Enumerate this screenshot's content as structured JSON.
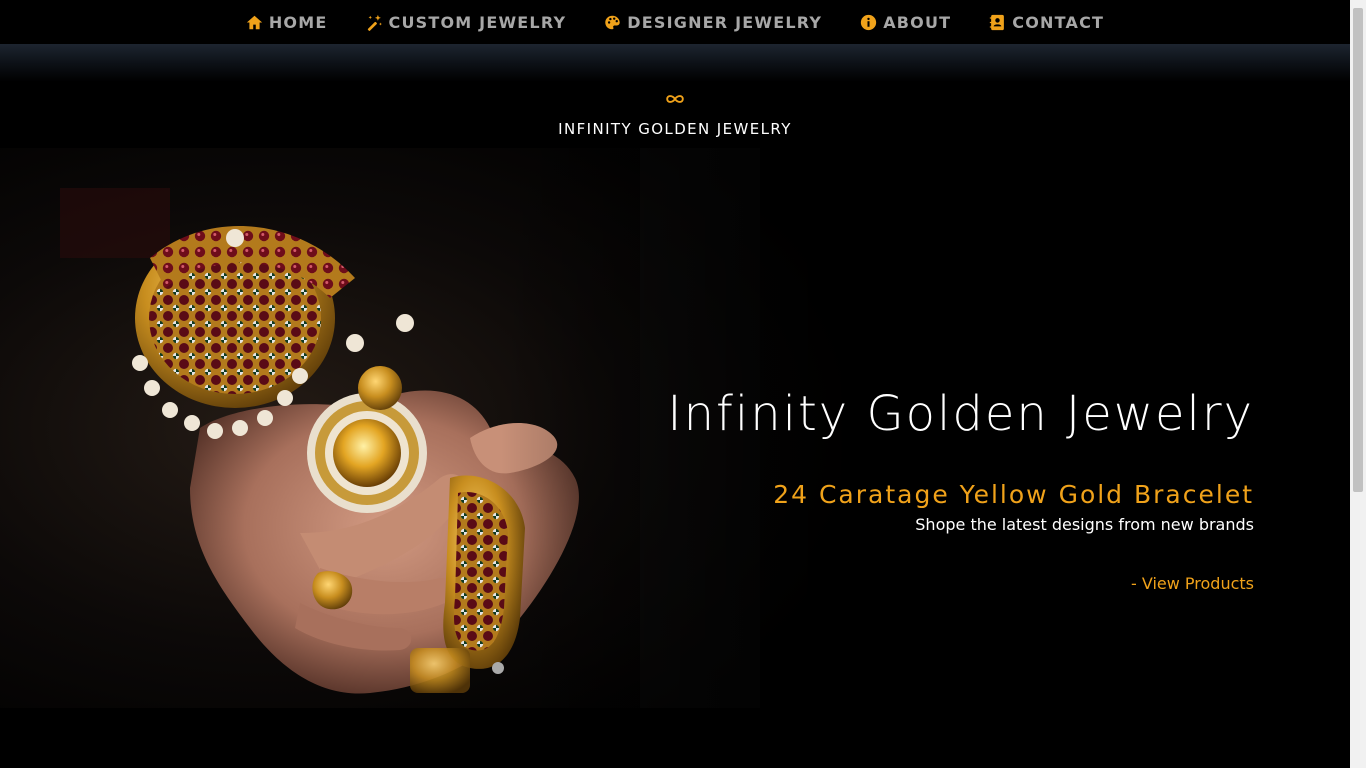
{
  "nav": {
    "items": [
      {
        "label": "HOME",
        "icon": "home-icon"
      },
      {
        "label": "CUSTOM JEWELRY",
        "icon": "magic-wand-icon"
      },
      {
        "label": "DESIGNER JEWELRY",
        "icon": "palette-icon"
      },
      {
        "label": "ABOUT",
        "icon": "info-icon"
      },
      {
        "label": "CONTACT",
        "icon": "contact-book-icon"
      }
    ]
  },
  "brand": {
    "logo_icon": "infinity-icon",
    "name": "INFINITY GOLDEN JEWELRY"
  },
  "hero": {
    "image": "hand-with-gold-jewelry-image",
    "title": "Infinity Golden Jewelry",
    "subtitle": "24 Caratage Yellow Gold Bracelet",
    "tagline": "Shope the latest designs from new brands",
    "link": "- View Products"
  },
  "colors": {
    "accent": "#f0a21a",
    "background": "#000000",
    "nav_text": "#a7a7a7",
    "icon": "#f0a21a"
  }
}
